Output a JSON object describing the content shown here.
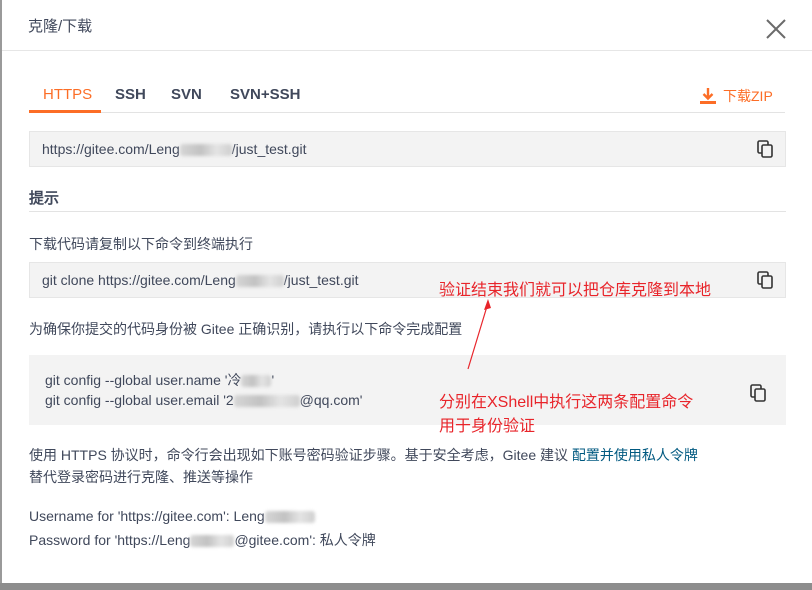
{
  "dialog": {
    "title": "克隆/下载",
    "close_icon": "close-icon"
  },
  "tabs": [
    {
      "label": "HTTPS",
      "active": true
    },
    {
      "label": "SSH",
      "active": false
    },
    {
      "label": "SVN",
      "active": false
    },
    {
      "label": "SVN+SSH",
      "active": false
    }
  ],
  "download_zip": {
    "label": "下载ZIP",
    "icon": "download-icon"
  },
  "repo_url": {
    "prefix": "https://gitee.com/Leng",
    "suffix": "/just_test.git"
  },
  "tips": {
    "heading": "提示",
    "clone_instruction": "下载代码请复制以下命令到终端执行",
    "clone_command": {
      "prefix": "git clone https://gitee.com/Leng",
      "suffix": "/just_test.git"
    },
    "identity_instruction": "为确保你提交的代码身份被 Gitee 正确识别，请执行以下命令完成配置",
    "config_name": {
      "prefix": "git config --global user.name '冷",
      "suffix": "'"
    },
    "config_email": {
      "prefix": "git config --global user.email '2",
      "suffix": "@qq.com'"
    },
    "https_note_line1_pre": "使用 HTTPS 协议时，命令行会出现如下账号密码验证步骤。基于安全考虑，Gitee 建议 ",
    "https_note_link": "配置并使用私人令牌",
    "https_note_line2": "替代登录密码进行克隆、推送等操作",
    "username_line": {
      "prefix": "Username for 'https://gitee.com': Leng",
      "suffix": ""
    },
    "password_line": {
      "prefix": "Password for 'https://Leng",
      "suffix": "@gitee.com': 私人令牌"
    }
  },
  "annotations": {
    "clone_note": "验证结束我们就可以把仓库克隆到本地",
    "config_note_line1": "分别在XShell中执行这两条配置命令",
    "config_note_line2": "用于身份验证"
  },
  "colors": {
    "accent": "#fc6d26",
    "link": "#005980",
    "annotation": "#e8242a"
  }
}
